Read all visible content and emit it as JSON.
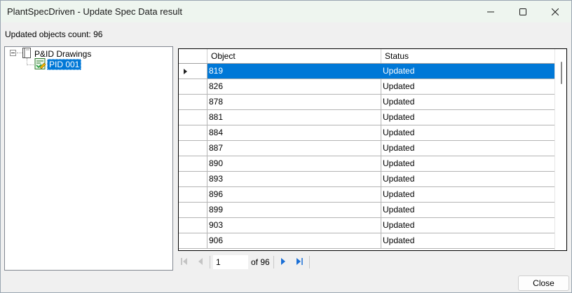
{
  "window": {
    "title": "PlantSpecDriven - Update Spec Data result"
  },
  "summary": {
    "updated_count_label": "Updated objects count: 96"
  },
  "tree": {
    "root_label": "P&ID Drawings",
    "child_label": "PID 001",
    "root_icon": "drawing-set-icon",
    "child_icon": "drawing-document-icon"
  },
  "grid": {
    "columns": [
      "Object",
      "Status"
    ],
    "rows": [
      {
        "object": "819",
        "status": "Updated"
      },
      {
        "object": "826",
        "status": "Updated"
      },
      {
        "object": "878",
        "status": "Updated"
      },
      {
        "object": "881",
        "status": "Updated"
      },
      {
        "object": "884",
        "status": "Updated"
      },
      {
        "object": "887",
        "status": "Updated"
      },
      {
        "object": "890",
        "status": "Updated"
      },
      {
        "object": "893",
        "status": "Updated"
      },
      {
        "object": "896",
        "status": "Updated"
      },
      {
        "object": "899",
        "status": "Updated"
      },
      {
        "object": "903",
        "status": "Updated"
      },
      {
        "object": "906",
        "status": "Updated"
      }
    ],
    "selected_row_index": 0
  },
  "pager": {
    "current_page": "1",
    "of_label": "of 96"
  },
  "buttons": {
    "close_label": "Close"
  },
  "colors": {
    "selection": "#0078d7",
    "titlebar": "#eef5ef",
    "window_bg": "#f0f0f0"
  }
}
